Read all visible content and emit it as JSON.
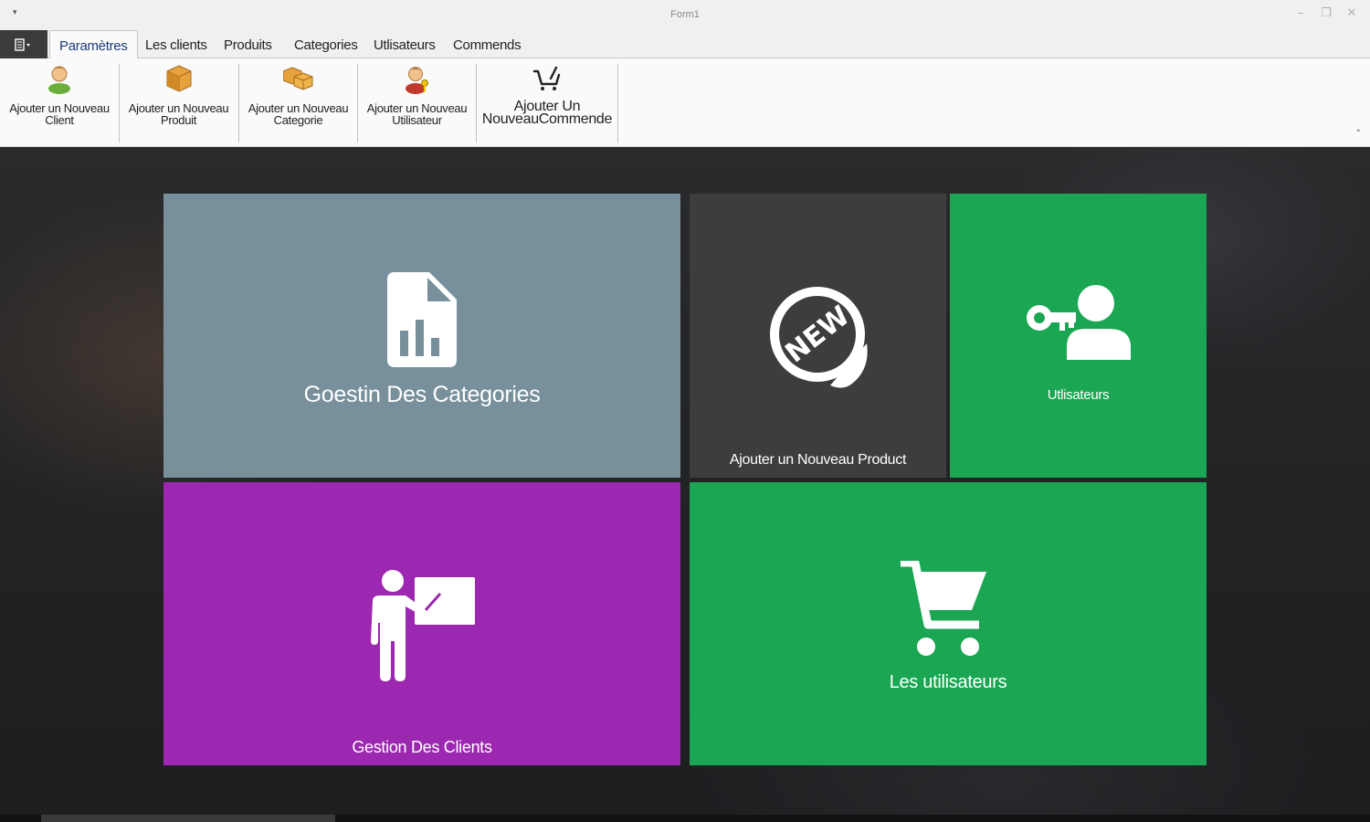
{
  "window": {
    "title": "Form1",
    "qat_glyph": "▾",
    "minimize": "–",
    "restore": "❐",
    "close": "✕"
  },
  "tabs": [
    {
      "label": "Paramètres",
      "active": true
    },
    {
      "label": "Les clients"
    },
    {
      "label": "Produits"
    },
    {
      "label": "Categories"
    },
    {
      "label": "Utlisateurs"
    },
    {
      "label": "Commends"
    }
  ],
  "ribbon": {
    "buttons": [
      {
        "line1": "Ajouter un Nouveau",
        "line2": "Client",
        "icon": "client-icon"
      },
      {
        "line1": "Ajouter un Nouveau",
        "line2": "Produit",
        "icon": "box-icon"
      },
      {
        "line1": "Ajouter un Nouveau",
        "line2": "Categorie",
        "icon": "boxes-icon"
      },
      {
        "line1": "Ajouter un Nouveau",
        "line2": "Utilisateur",
        "icon": "user-key-icon"
      },
      {
        "line1": "Ajouter Un",
        "line2": "NouveauCommende",
        "icon": "cart-icon"
      }
    ],
    "collapse_glyph": "˄"
  },
  "tiles": {
    "categories": {
      "label": "Goestin Des Categories",
      "color": "#78909c",
      "icon": "document-chart-icon"
    },
    "new_product": {
      "label": "Ajouter un Nouveau Product",
      "color": "#3d3d3d",
      "icon": "new-badge-icon",
      "badge_text": "NEW"
    },
    "users": {
      "label": "Utlisateurs",
      "color": "#1aa653",
      "icon": "user-key-icon"
    },
    "clients": {
      "label": "Gestion Des Clients",
      "color": "#9c27b0",
      "icon": "teacher-board-icon"
    },
    "les_utilisateurs": {
      "label": "Les utilisateurs",
      "color": "#1aa653",
      "icon": "shopping-cart-icon"
    }
  },
  "colors": {
    "accent_tab": "#1a3b7a",
    "ribbon_bg": "#fafafa",
    "file_button": "#3b3b3b"
  }
}
